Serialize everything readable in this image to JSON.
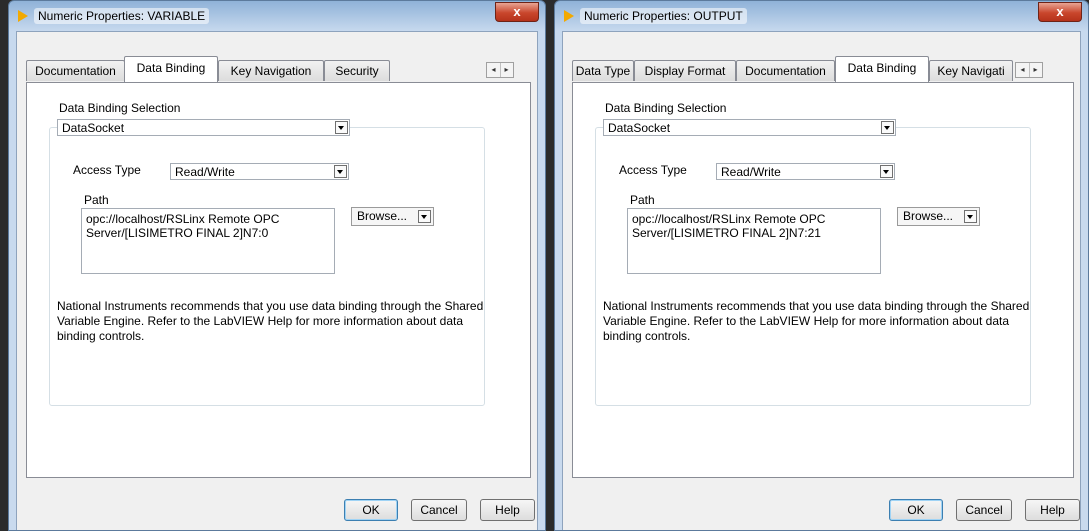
{
  "windows": [
    {
      "title": "Numeric Properties: VARIABLE",
      "close_label": "x",
      "tabs": [
        "Documentation",
        "Data Binding",
        "Key Navigation",
        "Security"
      ],
      "active_tab": "Data Binding",
      "data_binding_selection_label": "Data Binding Selection",
      "data_binding_selection_value": "DataSocket",
      "access_type_label": "Access Type",
      "access_type_value": "Read/Write",
      "path_label": "Path",
      "path_value": "opc://localhost/RSLinx Remote OPC\nServer/[LISIMETRO FINAL 2]N7:0",
      "browse_label": "Browse...",
      "note": "National Instruments recommends that you use data binding through the Shared Variable Engine.  Refer to the LabVIEW Help for more information about data binding controls.",
      "buttons": {
        "ok": "OK",
        "cancel": "Cancel",
        "help": "Help"
      }
    },
    {
      "title": "Numeric Properties: OUTPUT",
      "close_label": "x",
      "tabs": [
        "Data Type",
        "Display Format",
        "Documentation",
        "Data Binding",
        "Key Navigati"
      ],
      "active_tab": "Data Binding",
      "data_binding_selection_label": "Data Binding Selection",
      "data_binding_selection_value": "DataSocket",
      "access_type_label": "Access Type",
      "access_type_value": "Read/Write",
      "path_label": "Path",
      "path_value": "opc://localhost/RSLinx Remote OPC\nServer/[LISIMETRO FINAL 2]N7:21",
      "browse_label": "Browse...",
      "note": "National Instruments recommends that you use data binding through the Shared Variable Engine.  Refer to the LabVIEW Help for more information about data binding controls.",
      "buttons": {
        "ok": "OK",
        "cancel": "Cancel",
        "help": "Help"
      }
    }
  ]
}
